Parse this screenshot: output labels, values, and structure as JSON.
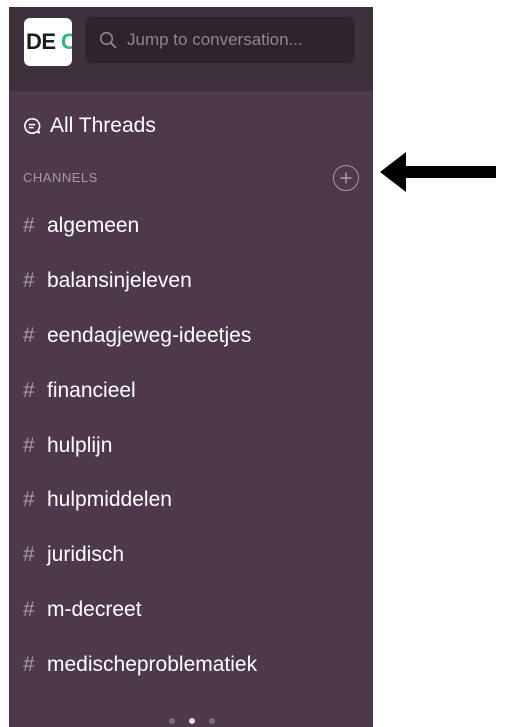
{
  "workspace": {
    "logo_text": "DE",
    "logo_accent": "C"
  },
  "search": {
    "placeholder": "Jump to conversation..."
  },
  "all_threads": {
    "label": "All Threads",
    "icon": "threads-icon"
  },
  "channels_section": {
    "title": "CHANNELS",
    "add_icon": "plus-circle-icon"
  },
  "channels": [
    {
      "hash": "#",
      "name": "algemeen"
    },
    {
      "hash": "#",
      "name": "balansinjeleven"
    },
    {
      "hash": "#",
      "name": "eendagjeweg-ideetjes"
    },
    {
      "hash": "#",
      "name": "financieel"
    },
    {
      "hash": "#",
      "name": "hulplijn"
    },
    {
      "hash": "#",
      "name": "hulpmiddelen"
    },
    {
      "hash": "#",
      "name": "juridisch"
    },
    {
      "hash": "#",
      "name": "m-decreet"
    },
    {
      "hash": "#",
      "name": "medischeproblematiek"
    }
  ],
  "pagination": {
    "count": 3,
    "active": 2
  },
  "colors": {
    "sidebar": "#4d394b",
    "topbar": "#3e313c",
    "muted": "#a898a5",
    "annotation_arrow": "#000000"
  }
}
